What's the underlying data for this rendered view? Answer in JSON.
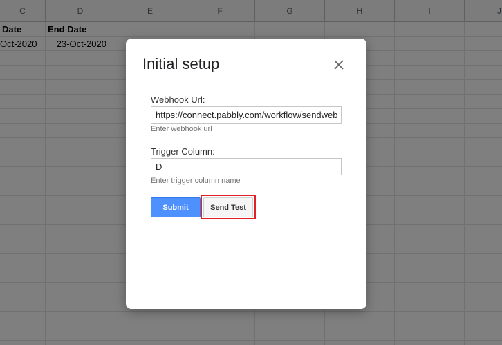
{
  "sheet": {
    "columns": [
      "C",
      "D",
      "E",
      "F",
      "G",
      "H",
      "I",
      "J"
    ],
    "header_row": [
      "Date",
      "End Date"
    ],
    "data_row": [
      "Oct-2020",
      "23-Oct-2020"
    ]
  },
  "dialog": {
    "title": "Initial setup",
    "webhook": {
      "label": "Webhook Url:",
      "value": "https://connect.pabbly.com/workflow/sendwebl",
      "hint": "Enter webhook url"
    },
    "trigger": {
      "label": "Trigger Column:",
      "value": "D",
      "hint": "Enter trigger column name"
    },
    "submit_label": "Submit",
    "send_test_label": "Send Test"
  },
  "icons": {
    "close": "close-icon"
  },
  "colors": {
    "accent": "#4d90fe",
    "highlight": "#e21f26"
  }
}
